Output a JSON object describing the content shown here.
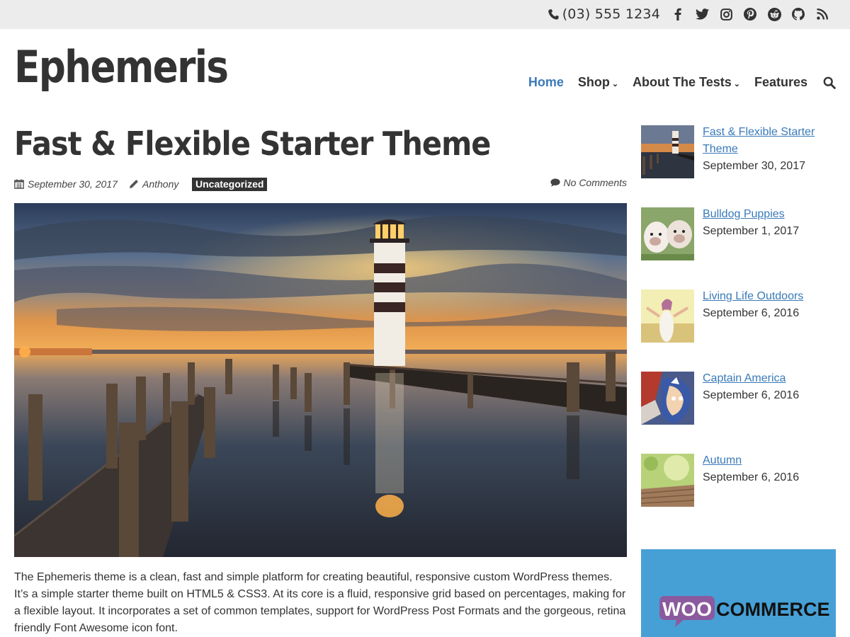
{
  "topbar": {
    "phone": "(03) 555 1234",
    "social": [
      "facebook-icon",
      "twitter-icon",
      "instagram-icon",
      "pinterest-icon",
      "reddit-icon",
      "github-icon",
      "rss-icon"
    ]
  },
  "site": {
    "title": "Ephemeris"
  },
  "nav": {
    "items": [
      {
        "label": "Home",
        "active": true,
        "dropdown": false
      },
      {
        "label": "Shop",
        "active": false,
        "dropdown": true
      },
      {
        "label": "About The Tests",
        "active": false,
        "dropdown": true
      },
      {
        "label": "Features",
        "active": false,
        "dropdown": false
      }
    ],
    "search_icon": "search-icon",
    "active_color": "#3a7ab8"
  },
  "post": {
    "title": "Fast & Flexible Starter Theme",
    "date": "September 30, 2017",
    "author": "Anthony",
    "category": "Uncategorized",
    "comments": "No Comments",
    "excerpt": "The Ephemeris theme is a clean, fast and simple platform for creating beautiful, responsive custom WordPress themes. It’s a simple starter theme built on HTML5 & CSS3. At its core is a fluid, responsive grid based on percentages, making for a flexible layout. It incorporates a set of common templates, support for WordPress Post Formats and the gorgeous, retina friendly Font Awesome icon font."
  },
  "sidebar": {
    "recent_posts": [
      {
        "title": "Fast & Flexible Starter Theme",
        "date": "September 30, 2017"
      },
      {
        "title": "Bulldog Puppies",
        "date": "September 1, 2017"
      },
      {
        "title": "Living Life Outdoors",
        "date": "September 6, 2016"
      },
      {
        "title": "Captain America",
        "date": "September 6, 2016"
      },
      {
        "title": "Autumn",
        "date": "September 6, 2016"
      }
    ],
    "ad": {
      "brand_left": "WOO",
      "brand_right": "COMMERCE",
      "background": "#46a0d6"
    }
  },
  "colors": {
    "link": "#3a7ab8",
    "text": "#333333",
    "topbar": "#ececec"
  }
}
